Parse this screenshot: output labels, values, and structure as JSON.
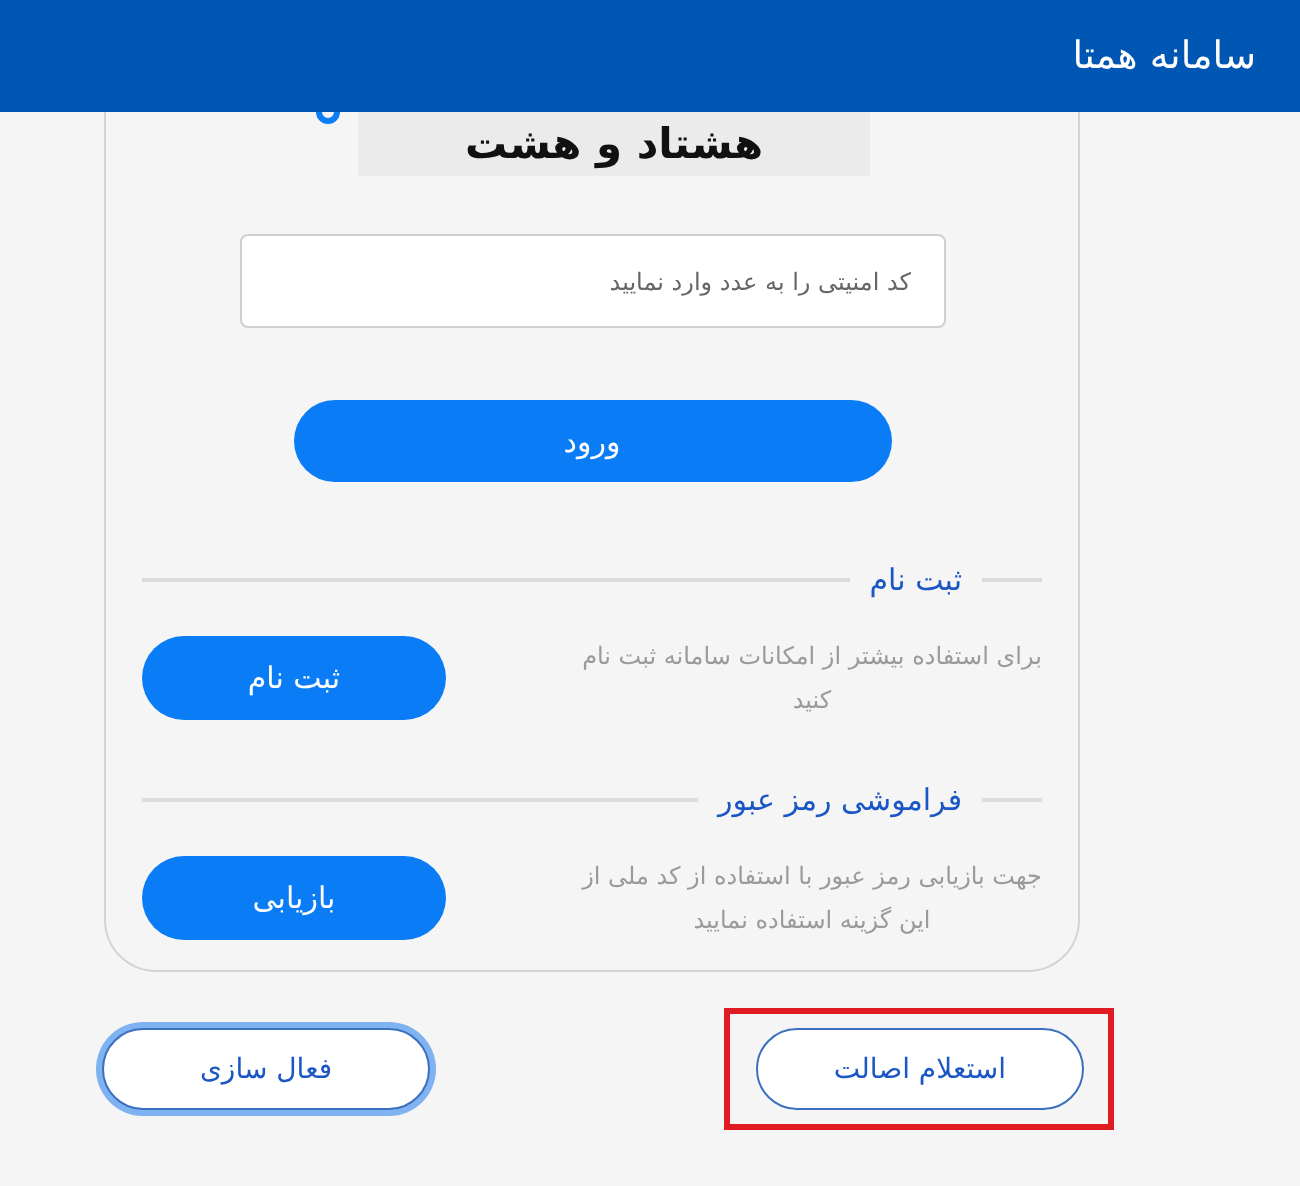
{
  "header": {
    "title": "سامانه همتا"
  },
  "captcha": {
    "text": "هشتاد و هشت"
  },
  "security_code": {
    "placeholder": "کد امنیتی را به عدد وارد نمایید"
  },
  "login_button": "ورود",
  "sections": [
    {
      "title": "ثبت نام",
      "description": "برای استفاده بیشتر از امکانات سامانه ثبت نام کنید",
      "button": "ثبت نام"
    },
    {
      "title": "فراموشی رمز عبور",
      "description": "جهت بازیابی رمز عبور با استفاده از کد ملی از این گزینه استفاده نمایید",
      "button": "بازیابی"
    }
  ],
  "footer_buttons": [
    {
      "label": "استعلام اصالت",
      "focused": false,
      "highlighted": true
    },
    {
      "label": "فعال سازی",
      "focused": true,
      "highlighted": false
    }
  ]
}
